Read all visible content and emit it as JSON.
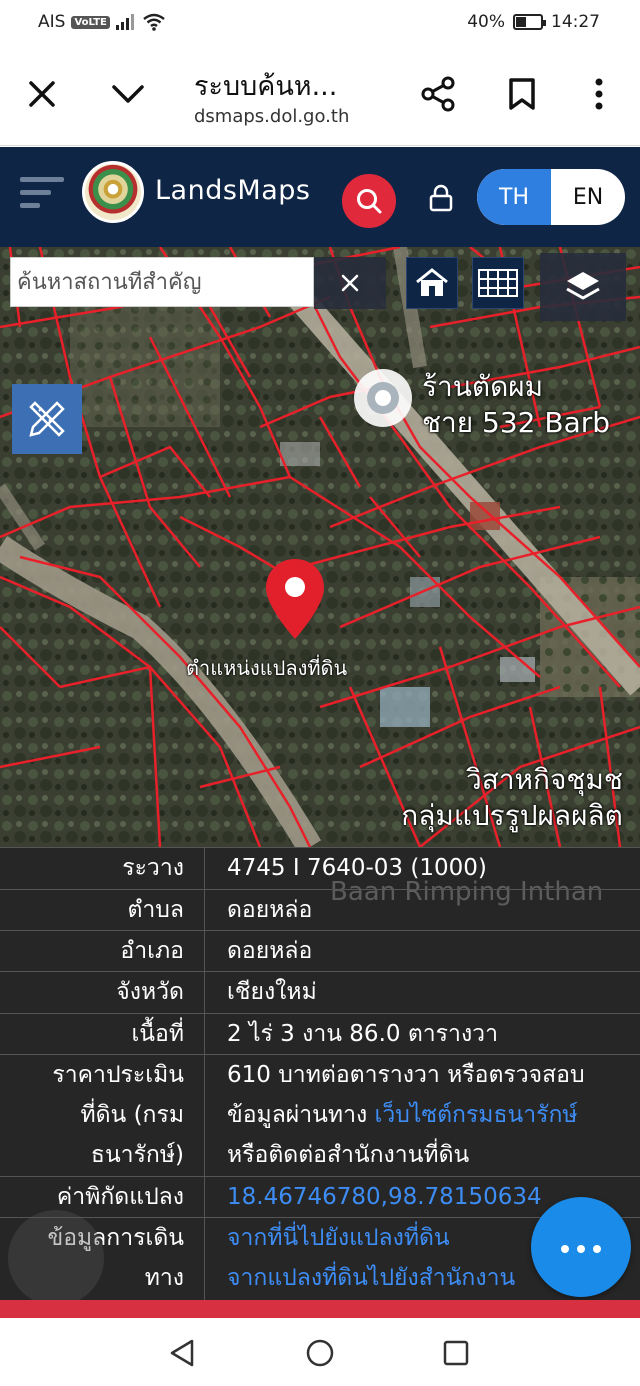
{
  "status_bar": {
    "carrier": "AIS",
    "volte": "VoLTE",
    "battery_text": "40%",
    "battery_level": 0.4,
    "time": "14:27"
  },
  "browser": {
    "title": "ระบบค้นห...",
    "url": "dsmaps.dol.go.th"
  },
  "app": {
    "brand": "LandsMaps",
    "lang_th": "TH",
    "lang_en": "EN",
    "selected_lang": "TH"
  },
  "map": {
    "search_placeholder": "ค้นหาสถานที่สำคัญ",
    "pin_label": "ตำแหน่งแปลงที่ดิน",
    "poi_label_line1": "ร้านตัดผม",
    "poi_label_line2": "ชาย 532 Barb",
    "poi2_label_line1": "วิสาหกิจชุมช",
    "poi2_label_line2": "กลุ่มแปรรูปผลผลิต",
    "watermark": "Baan Rimping Inthan"
  },
  "info": {
    "rows": [
      {
        "key": "ระวาง",
        "value": "4745 I 7640-03 (1000)"
      },
      {
        "key": "ตำบล",
        "value": "ดอยหล่อ"
      },
      {
        "key": "อำเภอ",
        "value": "ดอยหล่อ"
      },
      {
        "key": "จังหวัด",
        "value": "เชียงใหม่"
      },
      {
        "key": "เนื้อที่",
        "value": "2 ไร่ 3 งาน 86.0 ตารางวา"
      }
    ],
    "price": {
      "key_line1": "ราคาประเมิน",
      "key_line2": "ที่ดิน (กรม",
      "key_line3": "ธนารักษ์)",
      "line1": "610 บาทต่อตารางวา หรือตรวจสอบ",
      "line2_prefix": "ข้อมูลผ่านทาง",
      "line2_link": "เว็บไซต์กรมธนารักษ์",
      "line3": "หรือติดต่อสำนักงานที่ดิน"
    },
    "coords": {
      "key": "ค่าพิกัดแปลง",
      "value": "18.46746780,98.78150634"
    },
    "travel": {
      "key_line1": "ข้อมูลการเดิน",
      "key_line2": "ทาง",
      "link1": "จากที่นี่ไปยังแปลงที่ดิน",
      "link2": "จากแปลงที่ดินไปยังสำนักงาน"
    }
  },
  "colors": {
    "header_bg": "#0f2546",
    "accent_blue": "#2f7fe0",
    "search_red": "#e02a3c",
    "parcel_lines": "#e8202a",
    "link": "#3d8df5",
    "fab": "#1a8be8"
  },
  "icons": {
    "close": "close-icon",
    "expand": "chevron-down-icon",
    "share": "share-icon",
    "bookmark": "bookmark-icon",
    "more": "more-vertical-icon",
    "menu": "menu-icon",
    "search": "search-icon",
    "lock": "lock-icon",
    "home": "home-icon",
    "grid": "grid-icon",
    "layers": "layers-icon",
    "draw": "ruler-pencil-icon",
    "fab": "more-horizontal-icon"
  }
}
